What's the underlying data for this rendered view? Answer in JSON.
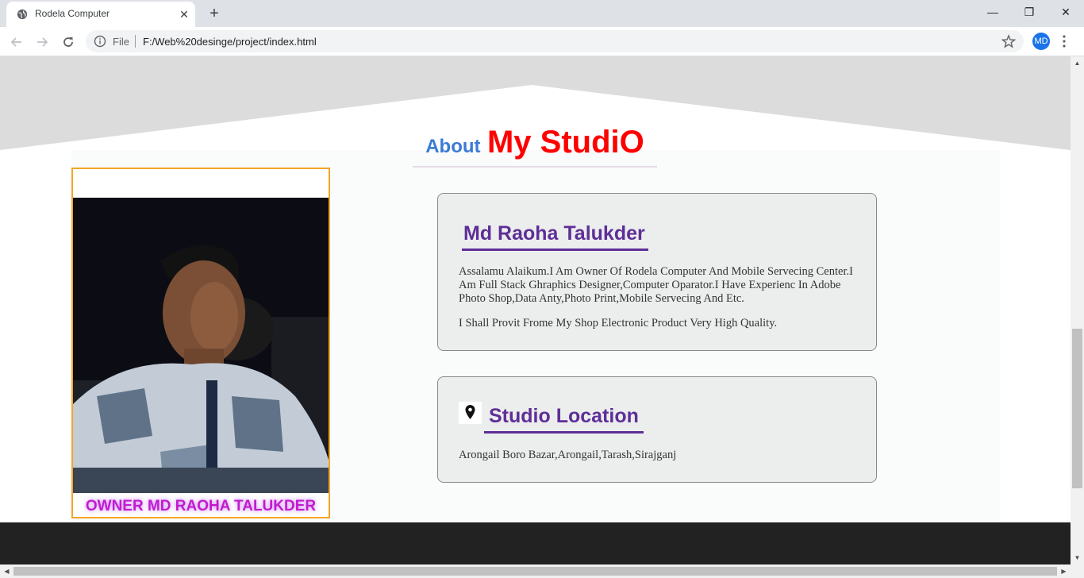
{
  "browser": {
    "tab_title": "Rodela Computer",
    "tab_close_glyph": "✕",
    "new_tab_glyph": "+",
    "address_scheme": "File",
    "address_url": "F:/Web%20desinge/project/index.html",
    "profile_initials": "MD",
    "window_controls": {
      "minimize": "—",
      "maximize": "❐",
      "close": "✕"
    }
  },
  "page": {
    "heading_small": "About",
    "heading_large": "My StudiO",
    "owner_caption": "OWNER MD RAOHA TALUKDER",
    "owner_card": {
      "title": "Md Raoha Talukder",
      "paragraph1": "Assalamu Alaikum.I Am Owner Of Rodela Computer And Mobile Servecing Center.I Am Full Stack Ghraphics Designer,Computer Oparator.I Have Experienc In Adobe Photo Shop,Data Anty,Photo Print,Mobile Servecing And Etc.",
      "paragraph2": "I Shall Provit Frome My Shop Electronic Product Very High Quality."
    },
    "location_card": {
      "title": "Studio Location",
      "address": "Arongail Boro Bazar,Arongail,Tarash,Sirajganj"
    }
  },
  "colors": {
    "heading_small": "#3a7bd5",
    "heading_large": "#ff0000",
    "card_title": "#5e2f97",
    "caption": "#c21bcc",
    "photo_border": "#f4a623",
    "footer": "#222222"
  },
  "icons": [
    "globe-icon",
    "close-icon",
    "plus-icon",
    "back-arrow-icon",
    "forward-arrow-icon",
    "reload-icon",
    "info-icon",
    "star-icon",
    "menu-icon",
    "map-pin-icon"
  ]
}
